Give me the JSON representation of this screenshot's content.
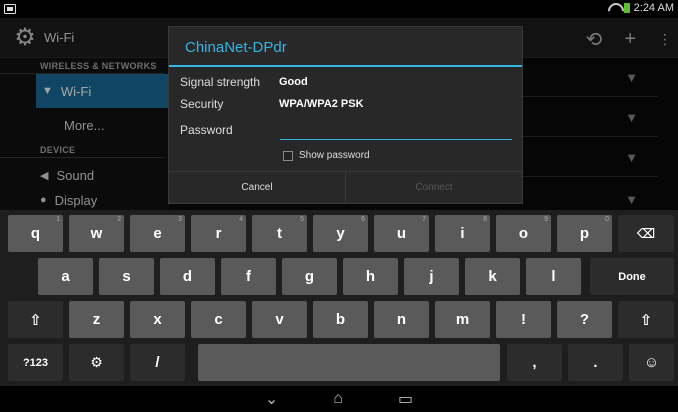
{
  "status_bar": {
    "time": "2:24 AM"
  },
  "action_bar": {
    "title": "Wi-Fi"
  },
  "settings_list": {
    "wireless_header": "WIRELESS & NETWORKS",
    "wifi_label": "Wi-Fi",
    "more_label": "More...",
    "device_header": "DEVICE",
    "sound_label": "Sound",
    "display_label": "Display"
  },
  "dialog": {
    "title": "ChinaNet-DPdr",
    "signal_label": "Signal strength",
    "signal_value": "Good",
    "security_label": "Security",
    "security_value": "WPA/WPA2 PSK",
    "password_label": "Password",
    "password_value": "",
    "show_password_label": "Show password",
    "cancel_label": "Cancel",
    "connect_label": "Connect"
  },
  "keyboard": {
    "row1": [
      {
        "label": "q",
        "hint": "1"
      },
      {
        "label": "w",
        "hint": "2"
      },
      {
        "label": "e",
        "hint": "3"
      },
      {
        "label": "r",
        "hint": "4"
      },
      {
        "label": "t",
        "hint": "5"
      },
      {
        "label": "y",
        "hint": "6"
      },
      {
        "label": "u",
        "hint": "7"
      },
      {
        "label": "i",
        "hint": "8"
      },
      {
        "label": "o",
        "hint": "9"
      },
      {
        "label": "p",
        "hint": "0"
      }
    ],
    "row2": [
      "a",
      "s",
      "d",
      "f",
      "g",
      "h",
      "j",
      "k",
      "l"
    ],
    "row3": [
      "z",
      "x",
      "c",
      "v",
      "b",
      "n",
      "m",
      "!",
      "?"
    ],
    "done_label": "Done",
    "symbols_label": "?123",
    "slash_label": "/",
    "comma_label": ",",
    "period_label": "."
  },
  "icons": {
    "backspace": "backspace-icon",
    "shift": "shift-icon",
    "settings": "gear-icon",
    "emoji": "emoji-icon",
    "back": "back-icon",
    "home": "home-icon",
    "recents": "recents-icon"
  },
  "colors": {
    "accent": "#33b5e5",
    "selected": "#1a6c99",
    "battery": "#5dc12f"
  }
}
